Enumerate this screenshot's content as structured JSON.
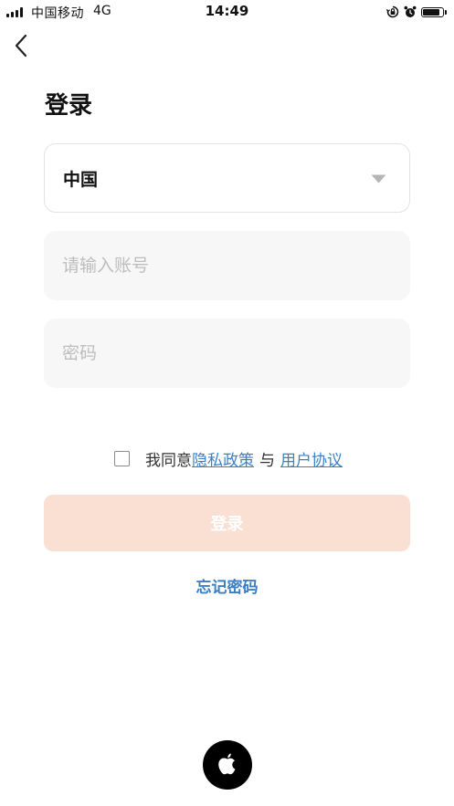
{
  "status_bar": {
    "carrier": "中国移动",
    "network": "4G",
    "time": "14:49",
    "battery_level": 0.85,
    "icons": [
      "signal-icon",
      "orientation-lock-icon",
      "alarm-icon",
      "battery-icon"
    ]
  },
  "nav": {
    "back_icon": "chevron-left-icon"
  },
  "page": {
    "title": "登录"
  },
  "form": {
    "country": {
      "value": "中国",
      "icon": "caret-down-icon"
    },
    "account": {
      "placeholder": "请输入账号",
      "value": ""
    },
    "password": {
      "placeholder": "密码",
      "value": ""
    },
    "agreement": {
      "checked": false,
      "prefix": "我同意",
      "privacy_link": "隐私政策",
      "conjunction": "与",
      "terms_link": "用户协议"
    },
    "submit_label": "登录",
    "forgot_label": "忘记密码"
  },
  "social": {
    "apple_icon": "apple-logo-icon"
  },
  "colors": {
    "accent_link": "#3b7fc4",
    "button_disabled_bg": "#f9e0d3",
    "field_bg": "#f7f7f7",
    "placeholder": "#bdbdbd"
  }
}
